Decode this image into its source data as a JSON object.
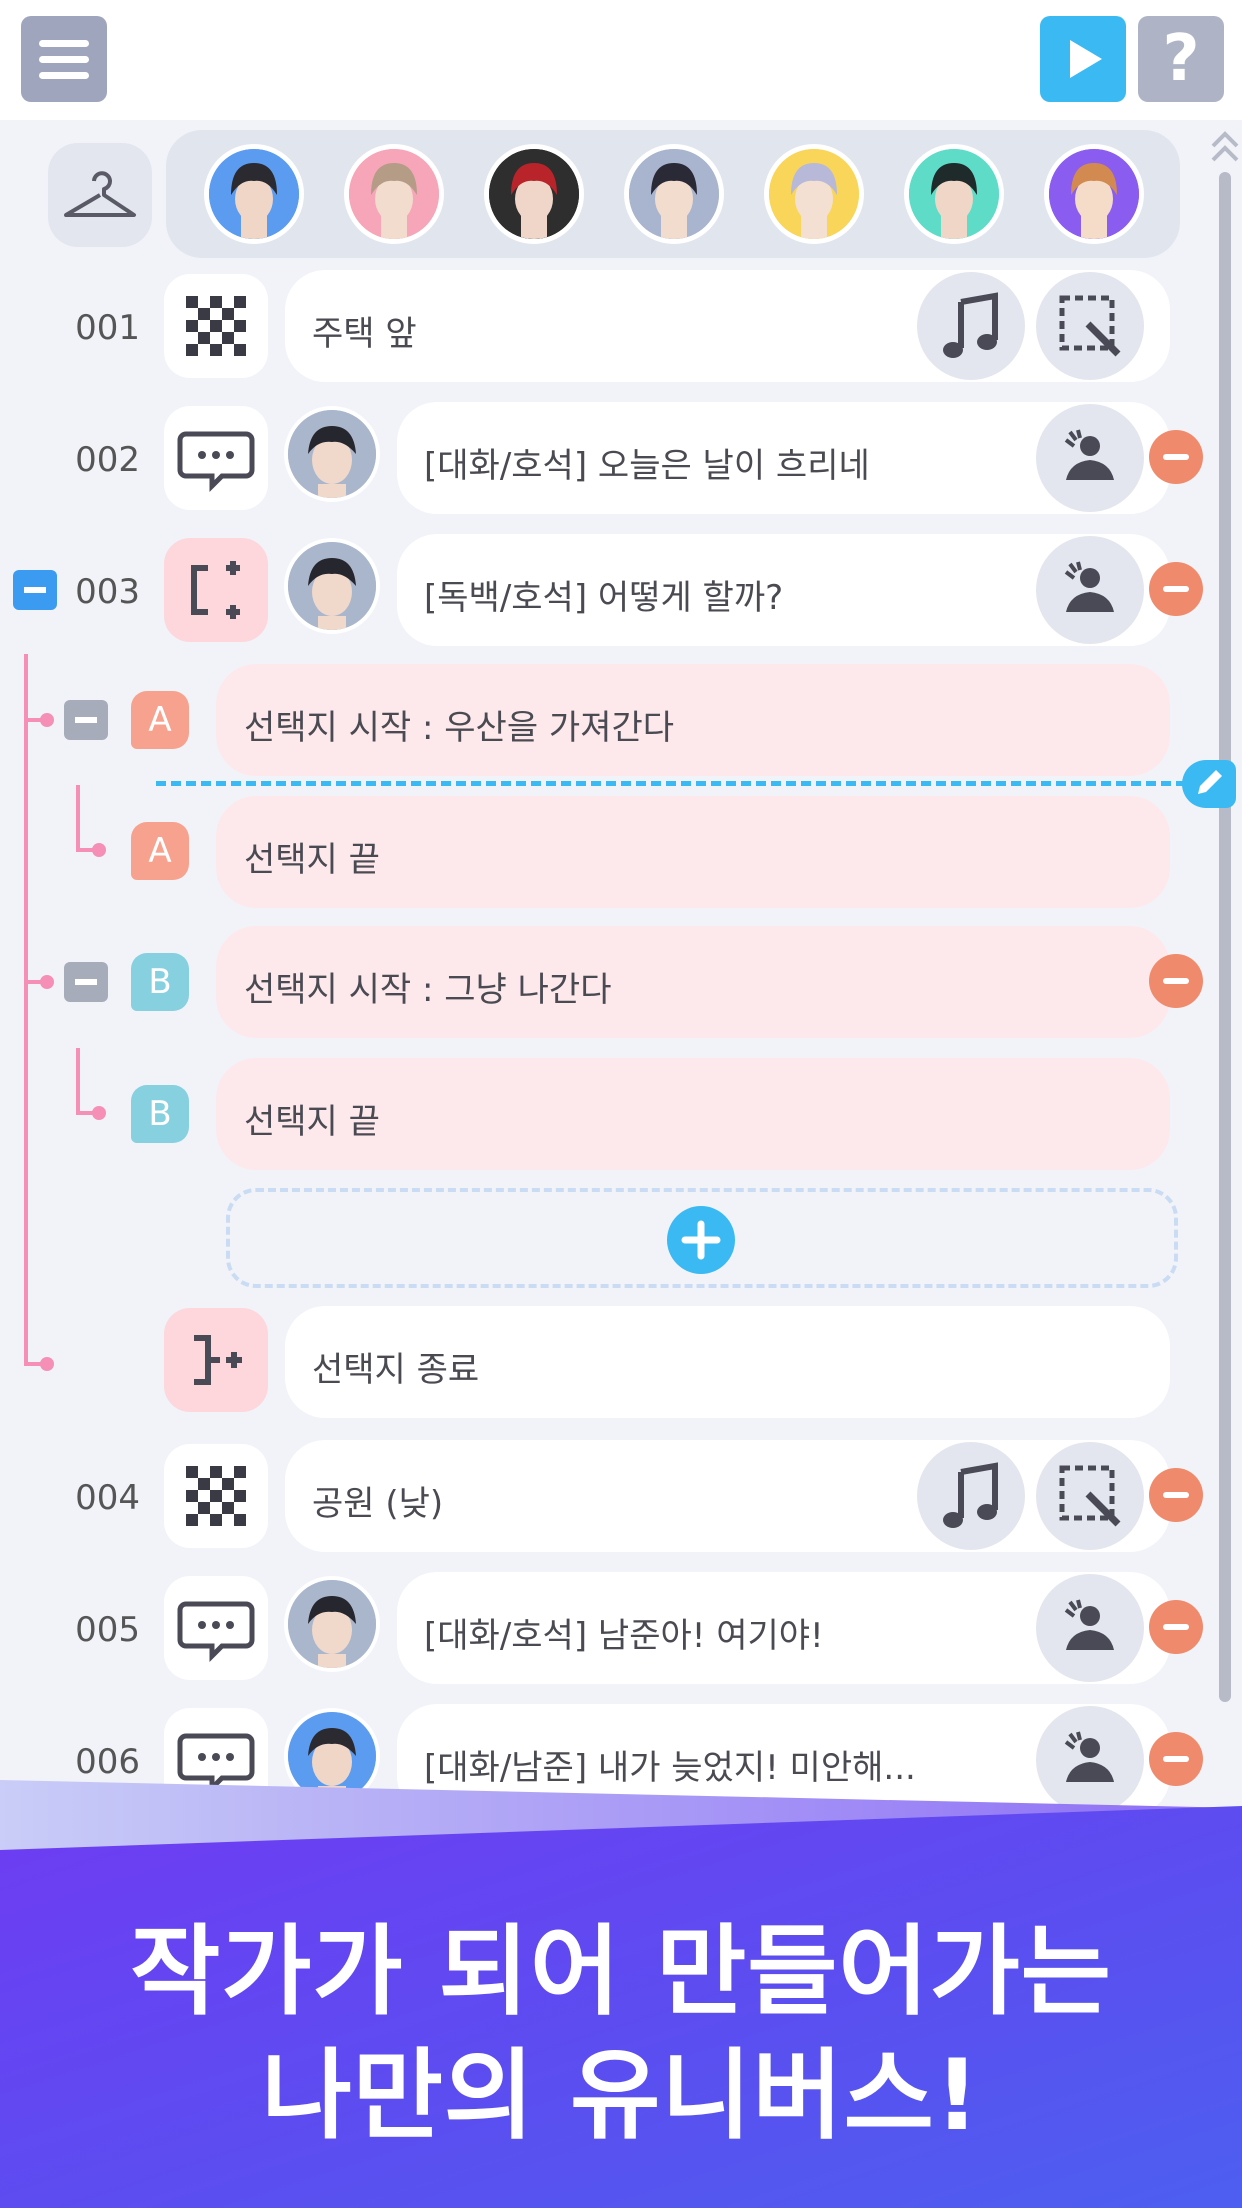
{
  "toolbar": {
    "help_label": "?"
  },
  "characters": [
    {
      "name": "namjoon",
      "bg": "#5b9cf0",
      "hair": "#2a2a30",
      "skin": "#f0d6c6"
    },
    {
      "name": "jin",
      "bg": "#f6a6b8",
      "hair": "#b59c86",
      "skin": "#f2dccd"
    },
    {
      "name": "jungkook-red",
      "bg": "#2e2e2e",
      "hair": "#b8242a",
      "skin": "#f0d6c8"
    },
    {
      "name": "hoseok",
      "bg": "#a9b5cf",
      "hair": "#2a2a36",
      "skin": "#f2dccd"
    },
    {
      "name": "jimin",
      "bg": "#f9d65a",
      "hair": "#b8b8d8",
      "skin": "#f4e0d2"
    },
    {
      "name": "taehyung",
      "bg": "#5fdcc8",
      "hair": "#1f2a2a",
      "skin": "#f0d6c6"
    },
    {
      "name": "jungkook",
      "bg": "#8b5cf0",
      "hair": "#d28a50",
      "skin": "#f4dcc8"
    }
  ],
  "rows": [
    {
      "num": "001",
      "text": "주택 앞"
    },
    {
      "num": "002",
      "text": "[대화/호석] 오늘은 날이 흐리네"
    },
    {
      "num": "003",
      "text": "[독백/호석] 어떻게 할까?"
    },
    {
      "num": "004",
      "text": "공원 (낮)"
    },
    {
      "num": "005",
      "text": "[대화/호석] 남준아! 여기야!"
    },
    {
      "num": "006",
      "text": "[대화/남준] 내가 늦었지! 미안해..."
    }
  ],
  "choices": {
    "a_start": "선택지 시작 : 우산을 가져간다",
    "a_end": "선택지 끝",
    "b_start": "선택지 시작 : 그냥 나간다",
    "b_end": "선택지 끝",
    "a_letter": "A",
    "b_letter": "B",
    "end_label": "선택지 종료"
  },
  "banner": {
    "line1": "작가가 되어 만들어가는",
    "line2": "나만의 유니버스!"
  },
  "colors": {
    "accent_blue": "#3bb9f2",
    "minus_orange": "#f08a6c",
    "choice_pink": "#fde9ec",
    "branch_line": "#f58fb6",
    "badge_a": "#f7a28e",
    "badge_b": "#86d0e0"
  }
}
